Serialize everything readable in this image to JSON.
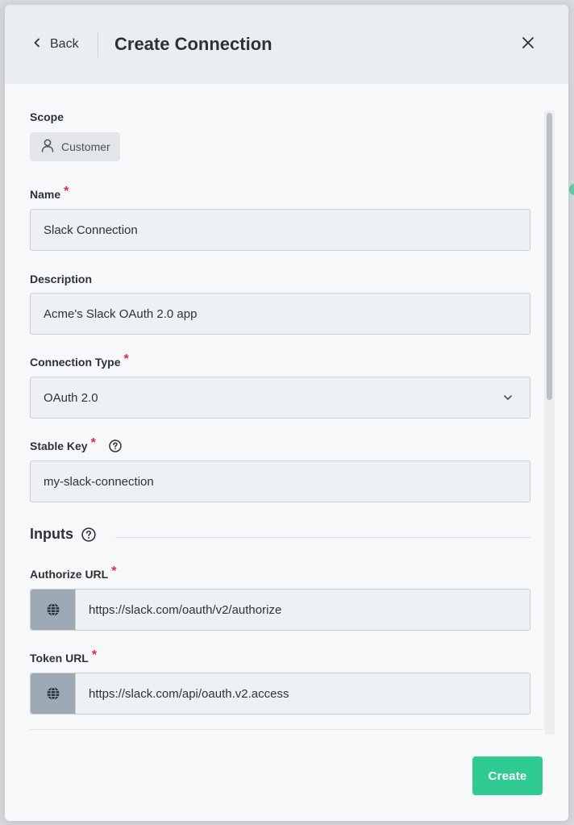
{
  "header": {
    "back_label": "Back",
    "title": "Create Connection"
  },
  "form": {
    "scope": {
      "label": "Scope",
      "value": "Customer"
    },
    "name": {
      "label": "Name",
      "value": "Slack Connection"
    },
    "description": {
      "label": "Description",
      "value": "Acme's Slack OAuth 2.0 app"
    },
    "connection_type": {
      "label": "Connection Type",
      "value": "OAuth 2.0"
    },
    "stable_key": {
      "label": "Stable Key",
      "value": "my-slack-connection"
    },
    "required_marker": "*"
  },
  "inputs_section": {
    "title": "Inputs",
    "authorize_url": {
      "label": "Authorize URL",
      "value": "https://slack.com/oauth/v2/authorize"
    },
    "token_url": {
      "label": "Token URL",
      "value": "https://slack.com/api/oauth.v2.access"
    }
  },
  "footer": {
    "create_label": "Create"
  },
  "colors": {
    "primary": "#2fcb93",
    "required": "#e5284f",
    "adornment": "#9daab5"
  }
}
